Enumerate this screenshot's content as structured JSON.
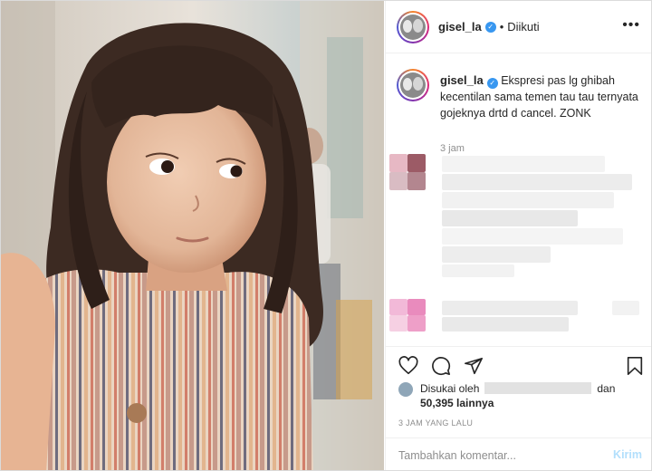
{
  "post": {
    "username": "gisel_la",
    "follow_status": "Diikuti",
    "more_label": "•••",
    "separator": "•"
  },
  "caption": {
    "username": "gisel_la",
    "text": "Ekspresi pas lg ghibah kecentilan sama temen tau tau ternyata gojeknya drtd d cancel. ZONK",
    "time": "3 jam"
  },
  "likes": {
    "prefix": "Disukai oleh",
    "suffix": "dan",
    "count_label": "50,395 lainnya"
  },
  "timestamp": "3 JAM YANG LALU",
  "comment": {
    "placeholder": "Tambahkan komentar...",
    "post_label": "Kirim"
  },
  "icons": {
    "verified": "verified-badge-icon",
    "like": "heart-icon",
    "comment": "speech-bubble-icon",
    "share": "paper-plane-icon",
    "save": "bookmark-icon",
    "more": "more-options-icon"
  },
  "colors": {
    "accent": "#3897f0",
    "post_button_disabled": "#b2dffc",
    "secondary_text": "#8e8e8e"
  }
}
